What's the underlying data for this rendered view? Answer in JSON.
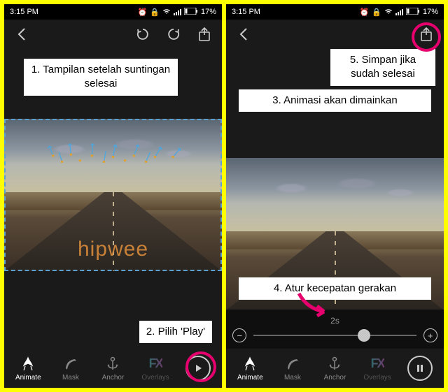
{
  "status": {
    "time": "3:15 PM",
    "battery_pct": "17%",
    "battery_icon": "battery-icon",
    "signal": true,
    "wifi": true,
    "alarm": true,
    "portrait_lock": true
  },
  "topbar": {
    "back": "‹",
    "undo": "undo-icon",
    "redo": "redo-icon",
    "share": "share-icon"
  },
  "watermark": "hipwee",
  "tabs": {
    "animate": "Animate",
    "mask": "Mask",
    "anchor": "Anchor",
    "overlays": "Overlays"
  },
  "speed": {
    "label": "2s",
    "minus": "−",
    "plus": "+"
  },
  "callouts": {
    "c1": "1. Tampilan setelah suntingan selesai",
    "c2": "2. Pilih 'Play'",
    "c3": "3. Animasi akan dimainkan",
    "c4": "4. Atur kecepatan gerakan",
    "c5": "5. Simpan jika sudah selesai"
  },
  "colors": {
    "accent_pink": "#e6006e",
    "bg_yellow": "#ffff00"
  }
}
